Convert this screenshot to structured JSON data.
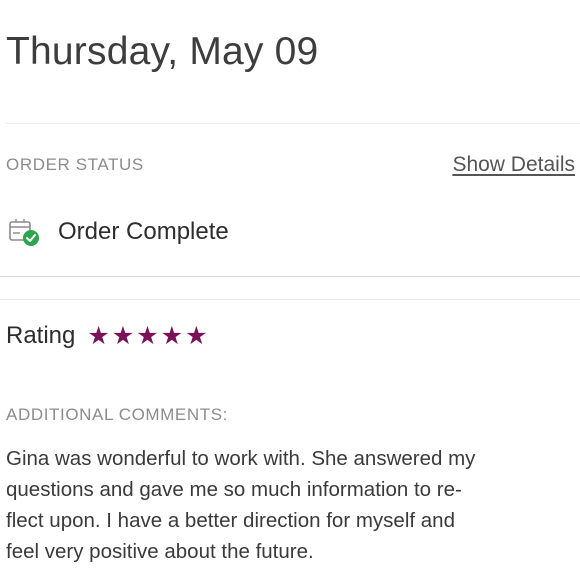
{
  "header": {
    "date": "Thursday, May 09"
  },
  "order": {
    "status_label": "ORDER STATUS",
    "show_details_label": "Show Details",
    "status_icon": "package-check-icon",
    "status_text": "Order Complete"
  },
  "rating": {
    "label": "Rating",
    "stars": 5,
    "max_stars": 5,
    "star_glyph": "★",
    "star_color": "#7a1257"
  },
  "comments": {
    "label": "ADDITIONAL COMMENTS:",
    "lines": [
      "Gina was wonderful to work with. She answered my",
      "questions and gave me so much information to re-",
      "flect upon. I have a better direction for myself and",
      "feel very positive about the future."
    ]
  },
  "colors": {
    "status_check": "#2ea44f",
    "accent_star": "#7a1257"
  }
}
